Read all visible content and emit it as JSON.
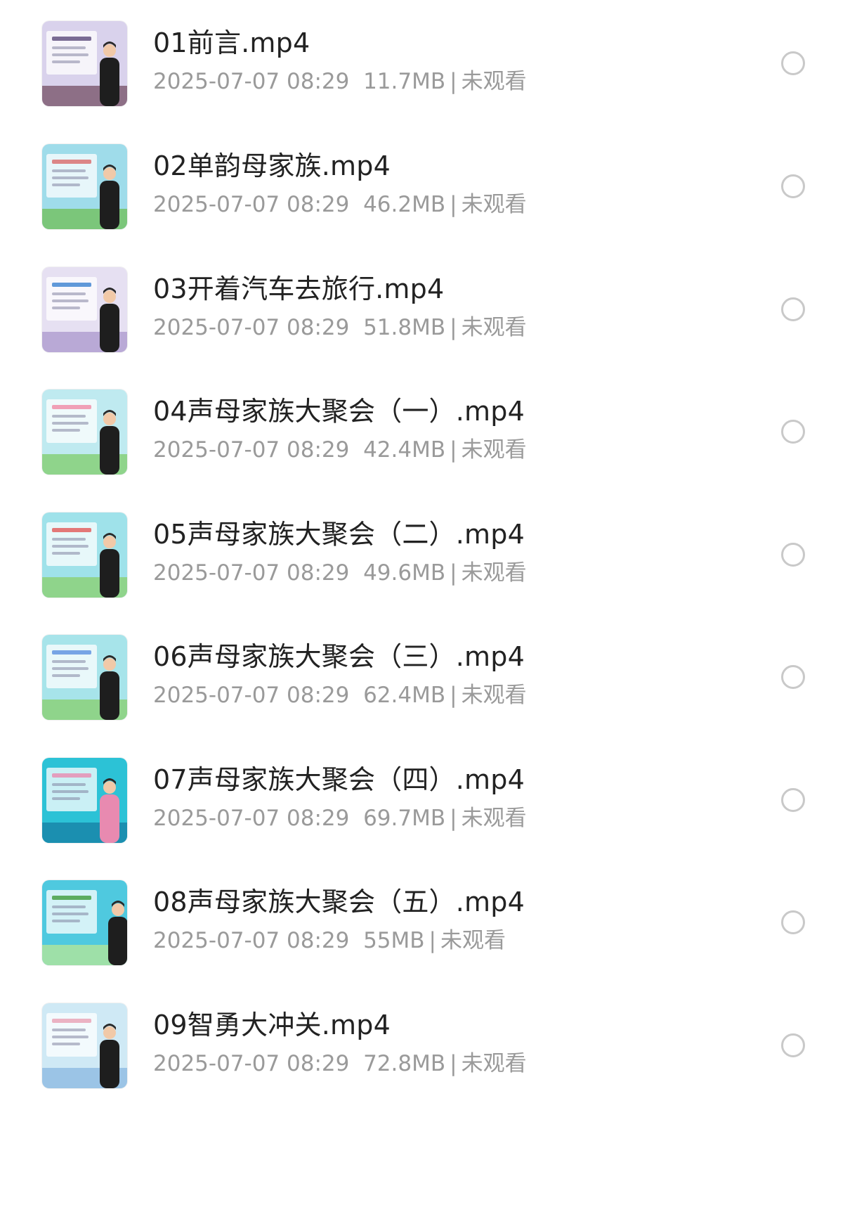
{
  "files": [
    {
      "name": "01前言.mp4",
      "date": "2025-07-07 08:29",
      "size": "11.7MB",
      "status": "未观看",
      "thumb": {
        "bg": "#d9d2ec",
        "floor": "#8d6f86",
        "accent": "#5b4a7a"
      }
    },
    {
      "name": "02单韵母家族.mp4",
      "date": "2025-07-07 08:29",
      "size": "46.2MB",
      "status": "未观看",
      "thumb": {
        "bg": "#9fdcea",
        "floor": "#7bc67a",
        "accent": "#d96a6a"
      }
    },
    {
      "name": "03开着汽车去旅行.mp4",
      "date": "2025-07-07 08:29",
      "size": "51.8MB",
      "status": "未观看",
      "thumb": {
        "bg": "#e6e0f2",
        "floor": "#b9a9d6",
        "accent": "#3a7fd0"
      }
    },
    {
      "name": "04声母家族大聚会（一）.mp4",
      "date": "2025-07-07 08:29",
      "size": "42.4MB",
      "status": "未观看",
      "thumb": {
        "bg": "#bfeaf0",
        "floor": "#8fd48b",
        "accent": "#f08aa5"
      }
    },
    {
      "name": "05声母家族大聚会（二）.mp4",
      "date": "2025-07-07 08:29",
      "size": "49.6MB",
      "status": "未观看",
      "thumb": {
        "bg": "#9fe2ea",
        "floor": "#8fd48b",
        "accent": "#e25757"
      }
    },
    {
      "name": "06声母家族大聚会（三）.mp4",
      "date": "2025-07-07 08:29",
      "size": "62.4MB",
      "status": "未观看",
      "thumb": {
        "bg": "#a7e4ea",
        "floor": "#8fd48b",
        "accent": "#5a8fe0"
      }
    },
    {
      "name": "07声母家族大聚会（四）.mp4",
      "date": "2025-07-07 08:29",
      "size": "69.7MB",
      "status": "未观看",
      "thumb": {
        "bg": "#2cc2d6",
        "floor": "#1b8fb0",
        "accent": "#e88ab0"
      }
    },
    {
      "name": "08声母家族大聚会（五）.mp4",
      "date": "2025-07-07 08:29",
      "size": "55MB",
      "status": "未观看",
      "thumb": {
        "bg": "#4fc9df",
        "floor": "#9ee0a8",
        "accent": "#3f9a3a"
      }
    },
    {
      "name": "09智勇大冲关.mp4",
      "date": "2025-07-07 08:29",
      "size": "72.8MB",
      "status": "未观看",
      "thumb": {
        "bg": "#cfe9f5",
        "floor": "#9bc4e6",
        "accent": "#e8a0b4"
      }
    }
  ],
  "separator": "|",
  "icons": {
    "radio": "radio-unchecked-icon",
    "thumbnail": "video-thumbnail"
  }
}
